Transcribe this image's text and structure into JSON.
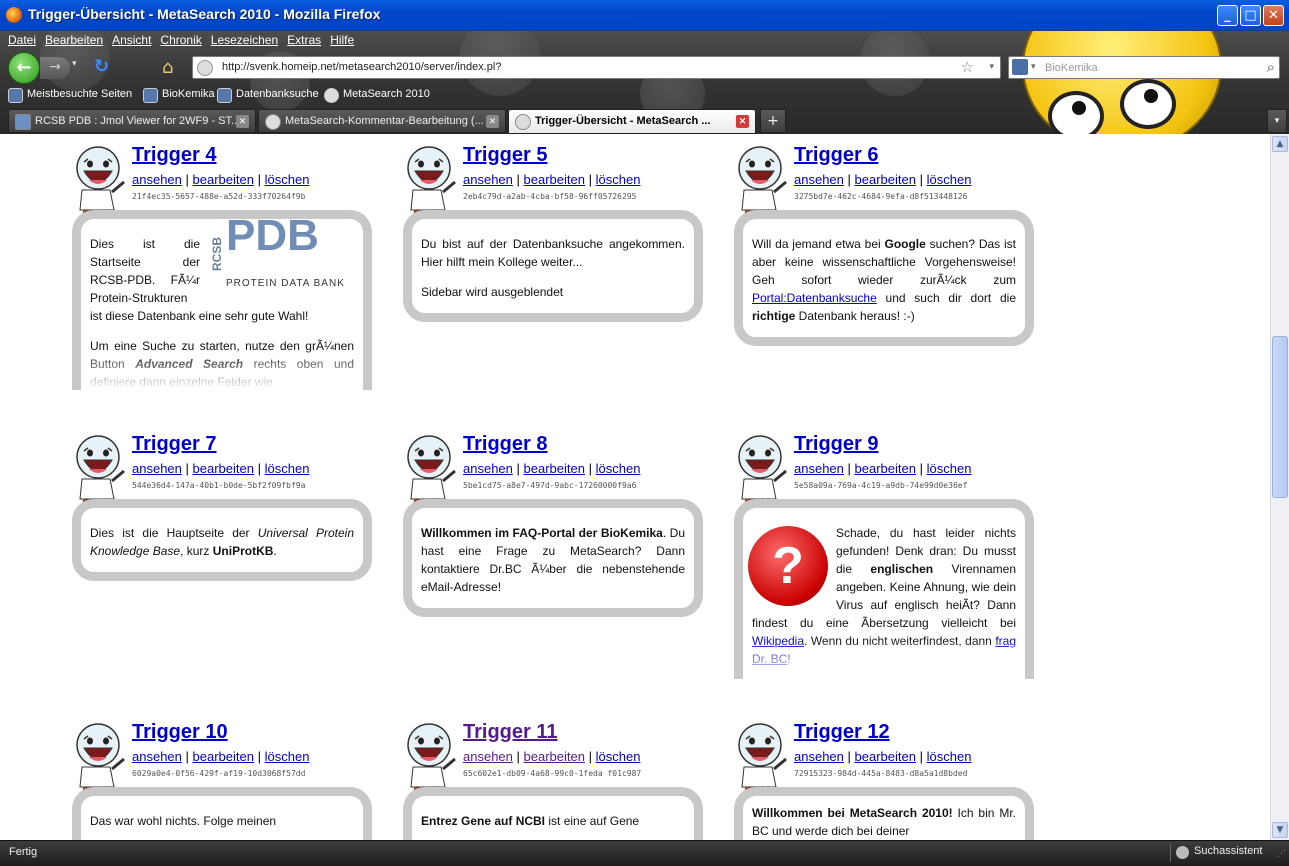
{
  "window": {
    "title": "Trigger-Übersicht - MetaSearch 2010 - Mozilla Firefox",
    "min": "_",
    "max": "□",
    "close": "✕"
  },
  "menu": [
    "Datei",
    "Bearbeiten",
    "Ansicht",
    "Chronik",
    "Lesezeichen",
    "Extras",
    "Hilfe"
  ],
  "nav": {
    "back": "←",
    "forward": "→",
    "dropdown": "▾",
    "reload": "↻",
    "home": "⌂",
    "url": "http://svenk.homeip.net/metasearch2010/server/index.pl?",
    "star": "☆",
    "url_dd": "▾"
  },
  "search": {
    "placeholder": "BioKemika",
    "engine_dd": "▾",
    "icon": "⌕"
  },
  "bookmarks": [
    {
      "label": "Meistbesuchte Seiten"
    },
    {
      "label": "BioKemika"
    },
    {
      "label": "Datenbanksuche"
    },
    {
      "label": "MetaSearch 2010"
    }
  ],
  "tabs": [
    {
      "label": "RCSB PDB : Jmol Viewer for 2WF9 - ST..."
    },
    {
      "label": "MetaSearch-Kommentar-Bearbeitung (..."
    },
    {
      "label": "Trigger-Übersicht - MetaSearch ..."
    }
  ],
  "tab_close": "✕",
  "new_tab": "+",
  "tab_list": "▾",
  "links": {
    "view": "ansehen",
    "edit": "bearbeiten",
    "delete": "löschen",
    "sep": "|"
  },
  "triggers": [
    {
      "title": "Trigger 4",
      "uuid": "21f4ec35-5657-488e-a52d-333f70264f9b"
    },
    {
      "title": "Trigger 5",
      "uuid": "2eb4c79d-a2ab-4cba-bf58-96ff05726295"
    },
    {
      "title": "Trigger 6",
      "uuid": "3275bd7e-462c-4684-9efa-d8f513448126"
    },
    {
      "title": "Trigger 7",
      "uuid": "544e36d4-147a-40b1-b0de-5bf2f09fbf9a"
    },
    {
      "title": "Trigger 8",
      "uuid": "5be1cd75-a8e7-497d-9abc-17260000f9a6"
    },
    {
      "title": "Trigger 9",
      "uuid": "5e58a09a-769a-4c19-a9db-74e99d0e36ef"
    },
    {
      "title": "Trigger 10",
      "uuid": "6029a0e4-0f56-429f-af19-10d3068f57dd"
    },
    {
      "title": "Trigger 11",
      "uuid": "65c602e1-db09-4a68-99c0-1feda f01c987"
    },
    {
      "title": "Trigger 12",
      "uuid": "72915323-984d-445a-8483-d8a5a1d8bded"
    }
  ],
  "t4": {
    "p1a": "Dies ist die Startseite der RCSB-PDB. FÃ¼r Protein-Strukturen ist diese Datenbank eine sehr gute Wahl!",
    "p2a": "Um eine Suche zu starten, nutze den grÃ¼nen Button ",
    "p2b": "Advanced Search",
    "p2c": " rechts oben und definiere dann einzelne Felder wie",
    "logo_rcsb": "RCSB",
    "logo_pdb": "PDB",
    "logo_sub": "PROTEIN DATA BANK"
  },
  "t5": {
    "p1": "Du bist auf der Datenbanksuche angekommen. Hier hilft mein Kollege weiter...",
    "p2": "Sidebar wird ausgeblendet"
  },
  "t6": {
    "a": "Will da jemand etwa bei ",
    "b": "Google",
    "c": " suchen? Das ist aber keine wissenschaftliche Vorgehensweise! Geh sofort wieder zurÃ¼ck zum ",
    "d": "Portal:Datenbanksuche",
    "e": " und such dir dort die ",
    "f": "richtige",
    "g": " Datenbank heraus! :-)"
  },
  "t7": {
    "a": "Dies ist die Hauptseite der ",
    "b": "Universal Protein Knowledge Base",
    "c": ", kurz ",
    "d": "UniProtKB",
    "e": "."
  },
  "t8": {
    "a": "Willkommen im FAQ-Portal der BioKemika",
    "b": ". Du hast eine Frage zu MetaSearch? Dann kontaktiere Dr.BC Ã¼ber die nebenstehende eMail-Adresse!"
  },
  "t9": {
    "a": "Schade, du hast leider nichts gefunden! Denk dran: Du musst die ",
    "b": "englischen",
    "c": " Virennamen angeben. Keine Ahnung, wie dein Virus auf englisch heiÃt? Dann findest du eine Ãbersetzung vielleicht bei ",
    "d": "Wikipedia",
    "e": ". Wenn du nicht weiterfindest, dann ",
    "f": "frag Dr. BC",
    "g": "!",
    "q": "?"
  },
  "t10": {
    "a": "Das war wohl nichts. Folge meinen"
  },
  "t11": {
    "a": "Entrez Gene auf NCBI",
    "b": " ist eine auf Gene"
  },
  "t12": {
    "a": "Willkommen bei MetaSearch 2010!",
    "b": " Ich bin Mr. BC und werde dich bei deiner"
  },
  "status": {
    "text": "Fertig",
    "assistant": "Suchassistent",
    "grip": "⋰"
  },
  "scroll": {
    "up": "▲",
    "down": "▼"
  }
}
